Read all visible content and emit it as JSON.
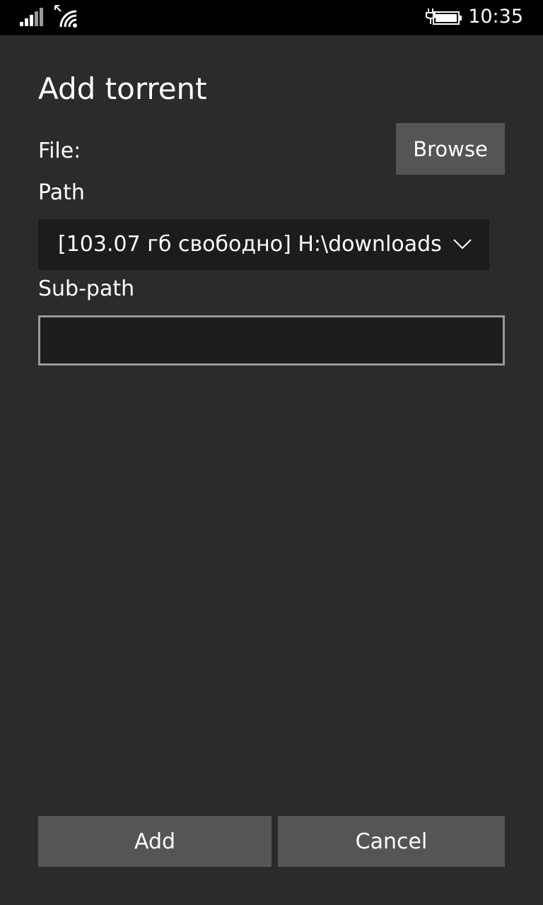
{
  "status_bar": {
    "time": "10:35",
    "signal_icon": "signal-bars-icon",
    "wifi_icon": "wifi-icon",
    "battery_icon": "battery-charging-icon"
  },
  "dialog": {
    "title": "Add torrent",
    "file_label": "File:",
    "browse_label": "Browse",
    "path_label": "Path",
    "path_value": "[103.07 гб свободно] H:\\downloads",
    "subpath_label": "Sub-path",
    "subpath_value": "",
    "add_label": "Add",
    "cancel_label": "Cancel"
  },
  "colors": {
    "background": "#2b2b2b",
    "status_bar": "#000000",
    "button": "#555555",
    "field": "#1c1c1c",
    "field_border": "#9a9a9a"
  }
}
